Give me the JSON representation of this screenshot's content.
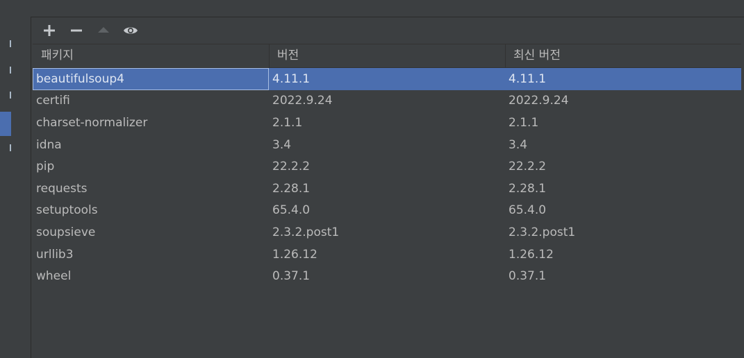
{
  "toolbar": {
    "add_icon": "plus-icon",
    "remove_icon": "minus-icon",
    "upgrade_icon": "triangle-up-icon",
    "show_icon": "eye-icon"
  },
  "table": {
    "columns": [
      "패키지",
      "버전",
      "최신 버전"
    ],
    "rows": [
      {
        "package": "beautifulsoup4",
        "version": "4.11.1",
        "latest": "4.11.1"
      },
      {
        "package": "certifi",
        "version": "2022.9.24",
        "latest": "2022.9.24"
      },
      {
        "package": "charset-normalizer",
        "version": "2.1.1",
        "latest": "2.1.1"
      },
      {
        "package": "idna",
        "version": "3.4",
        "latest": "3.4"
      },
      {
        "package": "pip",
        "version": "22.2.2",
        "latest": "22.2.2"
      },
      {
        "package": "requests",
        "version": "2.28.1",
        "latest": "2.28.1"
      },
      {
        "package": "setuptools",
        "version": "65.4.0",
        "latest": "65.4.0"
      },
      {
        "package": "soupsieve",
        "version": "2.3.2.post1",
        "latest": "2.3.2.post1"
      },
      {
        "package": "urllib3",
        "version": "1.26.12",
        "latest": "1.26.12"
      },
      {
        "package": "wheel",
        "version": "0.37.1",
        "latest": "0.37.1"
      }
    ]
  },
  "colors": {
    "background": "#3c3f41",
    "selection": "#4b6eaf",
    "text": "#bbbbbb"
  }
}
